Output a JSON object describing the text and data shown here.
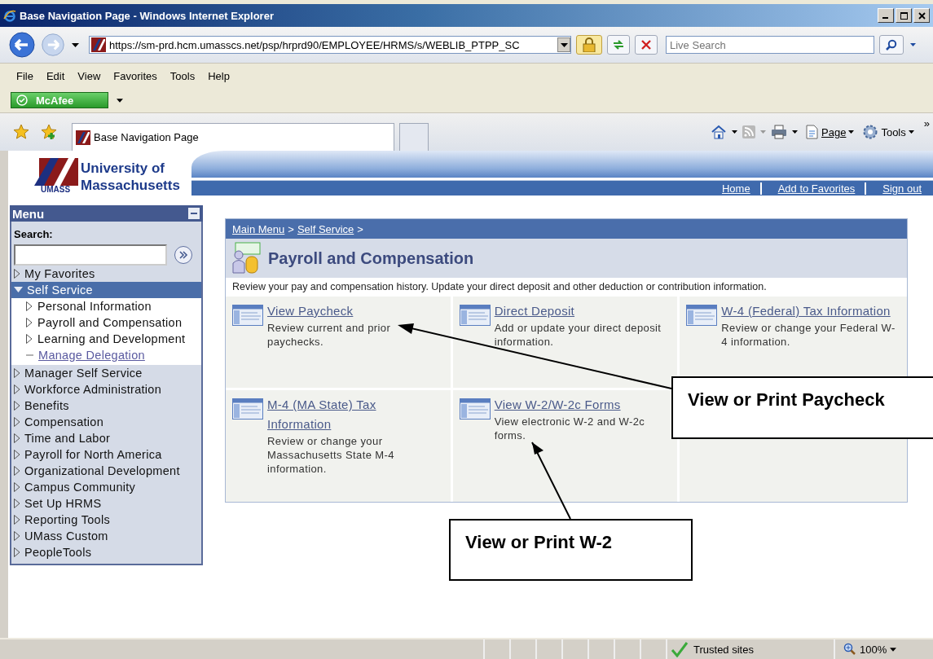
{
  "window": {
    "title": "Base Navigation Page - Windows Internet Explorer"
  },
  "address_bar": {
    "url": "https://sm-prd.hcm.umasscs.net/psp/hrprd90/EMPLOYEE/HRMS/s/WEBLIB_PTPP_SC"
  },
  "search": {
    "placeholder": "Live Search"
  },
  "menu_bar": [
    "File",
    "Edit",
    "View",
    "Favorites",
    "Tools",
    "Help"
  ],
  "mcafee": {
    "label": "McAfee"
  },
  "tab": {
    "title": "Base Navigation Page"
  },
  "command_bar": {
    "page": "Page",
    "tools": "Tools",
    "more": "»"
  },
  "site_header": {
    "logo_line1": "University of",
    "logo_line2": "Massachusetts",
    "logo_mark": "UMASS",
    "links": [
      "Home",
      "Add to Favorites",
      "Sign out"
    ]
  },
  "menu": {
    "title": "Menu",
    "search_label": "Search:",
    "items": [
      {
        "label": "My Favorites",
        "kind": "folder",
        "expanded": false,
        "selected": false
      },
      {
        "label": "Self Service",
        "kind": "folder",
        "expanded": true,
        "selected": true,
        "children": [
          {
            "label": "Personal Information",
            "kind": "folder",
            "expanded": false,
            "selected": false
          },
          {
            "label": "Payroll and Compensation",
            "kind": "folder",
            "expanded": false,
            "selected": false
          },
          {
            "label": "Learning and Development",
            "kind": "folder",
            "expanded": false,
            "selected": false
          },
          {
            "label": "Manage Delegation",
            "kind": "link",
            "selected": false
          }
        ]
      },
      {
        "label": "Manager Self Service",
        "kind": "folder",
        "expanded": false,
        "selected": false
      },
      {
        "label": "Workforce Administration",
        "kind": "folder",
        "expanded": false,
        "selected": false
      },
      {
        "label": "Benefits",
        "kind": "folder",
        "expanded": false,
        "selected": false
      },
      {
        "label": "Compensation",
        "kind": "folder",
        "expanded": false,
        "selected": false
      },
      {
        "label": "Time and Labor",
        "kind": "folder",
        "expanded": false,
        "selected": false
      },
      {
        "label": "Payroll for North America",
        "kind": "folder",
        "expanded": false,
        "selected": false
      },
      {
        "label": "Organizational Development",
        "kind": "folder",
        "expanded": false,
        "selected": false
      },
      {
        "label": "Campus Community",
        "kind": "folder",
        "expanded": false,
        "selected": false
      },
      {
        "label": "Set Up HRMS",
        "kind": "folder",
        "expanded": false,
        "selected": false
      },
      {
        "label": "Reporting Tools",
        "kind": "folder",
        "expanded": false,
        "selected": false
      },
      {
        "label": "UMass Custom",
        "kind": "folder",
        "expanded": false,
        "selected": false
      },
      {
        "label": "PeopleTools",
        "kind": "folder",
        "expanded": false,
        "selected": false
      }
    ]
  },
  "pagelet": {
    "breadcrumb": [
      "Main Menu",
      "Self Service"
    ],
    "separator": ">",
    "title": "Payroll and Compensation",
    "description": "Review your pay and compensation history. Update your direct deposit and other deduction or contribution information.",
    "tiles": [
      {
        "title": "View Paycheck",
        "description": "Review current and prior paychecks."
      },
      {
        "title": "Direct Deposit",
        "description": "Add or update your direct deposit information."
      },
      {
        "title": "W-4 (Federal) Tax Information",
        "description": "Review or change your Federal W-4 information."
      },
      {
        "title": "M-4 (MA State) Tax Information",
        "description": "Review or change your Massachusetts State M-4 information."
      },
      {
        "title": "View W-2/W-2c Forms",
        "description": "View electronic W-2 and W-2c forms."
      }
    ]
  },
  "annotations": [
    {
      "text": "View or Print Paycheck"
    },
    {
      "text": "View or Print W-2"
    }
  ],
  "status_bar": {
    "zone": "Trusted sites",
    "zoom": "100%"
  }
}
